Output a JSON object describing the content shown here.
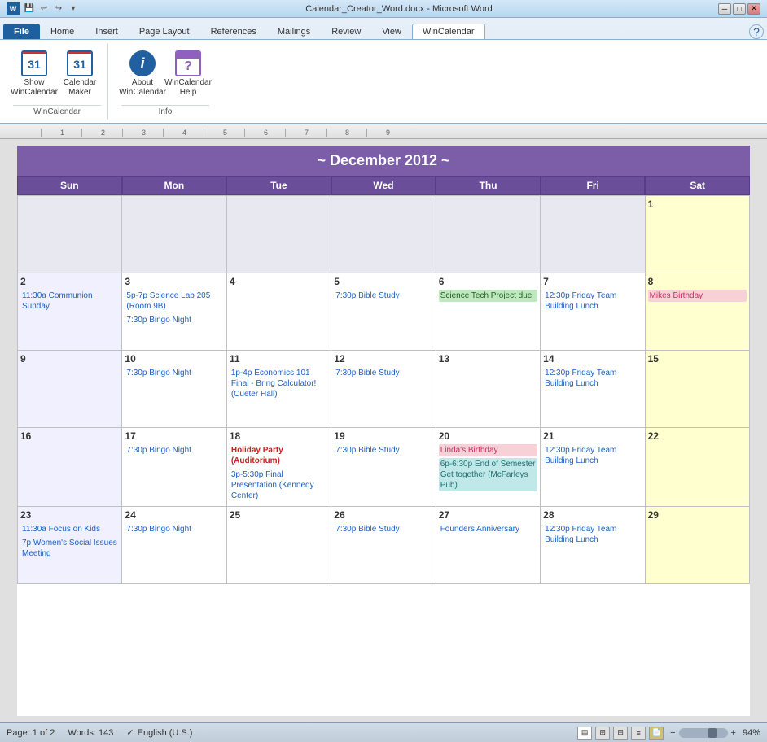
{
  "titleBar": {
    "title": "Calendar_Creator_Word.docx - Microsoft Word",
    "buttons": [
      "minimize",
      "maximize",
      "close"
    ]
  },
  "ribbon": {
    "tabs": [
      "File",
      "Home",
      "Insert",
      "Page Layout",
      "References",
      "Mailings",
      "Review",
      "View",
      "WinCalendar"
    ],
    "activeTab": "WinCalendar",
    "groups": {
      "wincalendar": {
        "label": "WinCalendar",
        "buttons": [
          {
            "id": "show-wincalendar",
            "label": "Show\nWinCalendar"
          },
          {
            "id": "calendar-maker",
            "label": "Calendar\nMaker"
          }
        ]
      },
      "info": {
        "label": "Info",
        "buttons": [
          {
            "id": "about-wincalendar",
            "label": "About\nWinCalendar"
          },
          {
            "id": "wincalendar-help",
            "label": "WinCalendar\nHelp"
          }
        ]
      }
    }
  },
  "calendar": {
    "title": "~ December 2012 ~",
    "dayHeaders": [
      "Sun",
      "Mon",
      "Tue",
      "Wed",
      "Thu",
      "Fri",
      "Sat"
    ],
    "weeks": [
      [
        {
          "date": "",
          "events": [],
          "type": "empty"
        },
        {
          "date": "",
          "events": [],
          "type": "empty"
        },
        {
          "date": "",
          "events": [],
          "type": "empty"
        },
        {
          "date": "",
          "events": [],
          "type": "empty"
        },
        {
          "date": "",
          "events": [],
          "type": "empty"
        },
        {
          "date": "",
          "events": [],
          "type": "empty"
        },
        {
          "date": "1",
          "events": [],
          "type": "weekend-sat"
        }
      ],
      [
        {
          "date": "2",
          "events": [
            {
              "text": "11:30a Communion Sunday",
              "style": "event-blue"
            }
          ],
          "type": "weekend-sun"
        },
        {
          "date": "3",
          "events": [
            {
              "text": "5p-7p Science Lab 205 (Room 9B)",
              "style": "event-blue"
            },
            {
              "text": "7:30p Bingo Night",
              "style": "event-blue"
            }
          ],
          "type": "weekday"
        },
        {
          "date": "4",
          "events": [],
          "type": "weekday"
        },
        {
          "date": "5",
          "events": [
            {
              "text": "7:30p Bible Study",
              "style": "event-blue"
            }
          ],
          "type": "weekday"
        },
        {
          "date": "6",
          "events": [
            {
              "text": "Science Tech Project due",
              "style": "event-green"
            }
          ],
          "type": "weekday"
        },
        {
          "date": "7",
          "events": [
            {
              "text": "12:30p Friday Team Building Lunch",
              "style": "event-blue"
            }
          ],
          "type": "weekday"
        },
        {
          "date": "8",
          "events": [
            {
              "text": "Mikes Birthday",
              "style": "event-pink"
            }
          ],
          "type": "weekend-sat"
        }
      ],
      [
        {
          "date": "9",
          "events": [],
          "type": "weekend-sun"
        },
        {
          "date": "10",
          "events": [
            {
              "text": "7:30p Bingo Night",
              "style": "event-blue"
            }
          ],
          "type": "weekday"
        },
        {
          "date": "11",
          "events": [
            {
              "text": "1p-4p Economics 101 Final - Bring Calculator! (Cueter Hall)",
              "style": "event-blue"
            }
          ],
          "type": "weekday"
        },
        {
          "date": "12",
          "events": [
            {
              "text": "7:30p Bible Study",
              "style": "event-blue"
            }
          ],
          "type": "weekday"
        },
        {
          "date": "13",
          "events": [],
          "type": "weekday"
        },
        {
          "date": "14",
          "events": [
            {
              "text": "12:30p Friday Team Building Lunch",
              "style": "event-blue"
            }
          ],
          "type": "weekday"
        },
        {
          "date": "15",
          "events": [],
          "type": "weekend-sat"
        }
      ],
      [
        {
          "date": "16",
          "events": [],
          "type": "weekend-sun"
        },
        {
          "date": "17",
          "events": [
            {
              "text": "7:30p Bingo Night",
              "style": "event-blue"
            }
          ],
          "type": "weekday"
        },
        {
          "date": "18",
          "events": [
            {
              "text": "Holiday Party (Auditorium)",
              "style": "event-red"
            },
            {
              "text": "3p-5:30p Final Presentation (Kennedy Center)",
              "style": "event-blue"
            }
          ],
          "type": "weekday"
        },
        {
          "date": "19",
          "events": [
            {
              "text": "7:30p Bible Study",
              "style": "event-blue"
            }
          ],
          "type": "weekday"
        },
        {
          "date": "20",
          "events": [
            {
              "text": "Linda's Birthday",
              "style": "event-pink"
            },
            {
              "text": "6p-6:30p End of Semester Get together (McFarleys Pub)",
              "style": "event-teal"
            }
          ],
          "type": "weekday"
        },
        {
          "date": "21",
          "events": [
            {
              "text": "12:30p Friday Team Building Lunch",
              "style": "event-blue"
            }
          ],
          "type": "weekday"
        },
        {
          "date": "22",
          "events": [],
          "type": "weekend-sat"
        }
      ],
      [
        {
          "date": "23",
          "events": [
            {
              "text": "11:30a Focus on Kids",
              "style": "event-blue"
            },
            {
              "text": "7p Women's Social Issues Meeting",
              "style": "event-blue"
            }
          ],
          "type": "weekend-sun"
        },
        {
          "date": "24",
          "events": [
            {
              "text": "7:30p Bingo Night",
              "style": "event-blue"
            }
          ],
          "type": "weekday"
        },
        {
          "date": "25",
          "events": [],
          "type": "weekday"
        },
        {
          "date": "26",
          "events": [
            {
              "text": "7:30p Bible Study",
              "style": "event-blue"
            }
          ],
          "type": "weekday"
        },
        {
          "date": "27",
          "events": [
            {
              "text": "Founders Anniversary",
              "style": "event-blue"
            }
          ],
          "type": "weekday"
        },
        {
          "date": "28",
          "events": [
            {
              "text": "12:30p Friday Team Building Lunch",
              "style": "event-blue"
            }
          ],
          "type": "weekday"
        },
        {
          "date": "29",
          "events": [],
          "type": "weekend-sat"
        }
      ]
    ]
  },
  "statusBar": {
    "page": "Page: 1 of 2",
    "words": "Words: 143",
    "language": "English (U.S.)",
    "zoom": "94%"
  }
}
